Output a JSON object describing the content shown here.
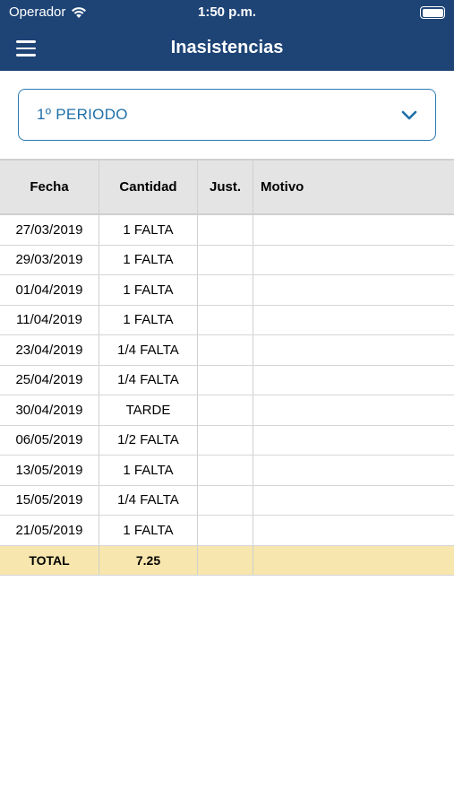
{
  "status_bar": {
    "carrier": "Operador",
    "time": "1:50 p.m."
  },
  "nav": {
    "title": "Inasistencias"
  },
  "period_select": {
    "selected": "1º PERIODO"
  },
  "table": {
    "headers": [
      "Fecha",
      "Cantidad",
      "Just.",
      "Motivo"
    ],
    "rows": [
      {
        "fecha": "27/03/2019",
        "cantidad": "1 FALTA",
        "just": "",
        "motivo": ""
      },
      {
        "fecha": "29/03/2019",
        "cantidad": "1 FALTA",
        "just": "",
        "motivo": ""
      },
      {
        "fecha": "01/04/2019",
        "cantidad": "1 FALTA",
        "just": "",
        "motivo": ""
      },
      {
        "fecha": "11/04/2019",
        "cantidad": "1 FALTA",
        "just": "",
        "motivo": ""
      },
      {
        "fecha": "23/04/2019",
        "cantidad": "1/4 FALTA",
        "just": "",
        "motivo": ""
      },
      {
        "fecha": "25/04/2019",
        "cantidad": "1/4 FALTA",
        "just": "",
        "motivo": ""
      },
      {
        "fecha": "30/04/2019",
        "cantidad": "TARDE",
        "just": "",
        "motivo": ""
      },
      {
        "fecha": "06/05/2019",
        "cantidad": "1/2 FALTA",
        "just": "",
        "motivo": ""
      },
      {
        "fecha": "13/05/2019",
        "cantidad": "1 FALTA",
        "just": "",
        "motivo": ""
      },
      {
        "fecha": "15/05/2019",
        "cantidad": "1/4 FALTA",
        "just": "",
        "motivo": ""
      },
      {
        "fecha": "21/05/2019",
        "cantidad": "1 FALTA",
        "just": "",
        "motivo": ""
      }
    ],
    "total": {
      "label": "TOTAL",
      "value": "7.25",
      "just": "",
      "motivo": ""
    }
  },
  "colors": {
    "header_bar": "#1e4476",
    "accent": "#2a7ab3",
    "total_row": "#f7e6ad",
    "table_header": "#e4e4e4"
  }
}
